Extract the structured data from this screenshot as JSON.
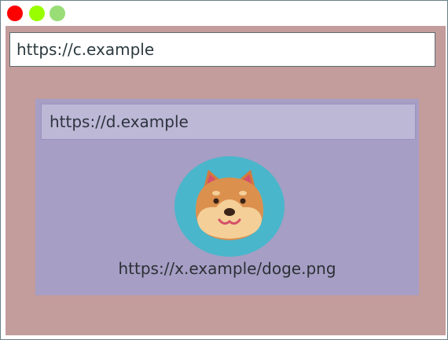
{
  "window": {
    "traffic_lights": [
      {
        "name": "close",
        "color": "#ff0000"
      },
      {
        "name": "minimize",
        "color": "#99ff00"
      },
      {
        "name": "maximize",
        "color": "#99dd77"
      }
    ]
  },
  "outer_frame": {
    "url": "https://c.example",
    "background": "#c39c9c"
  },
  "inner_frame": {
    "url": "https://d.example",
    "background": "#a69ec4",
    "url_bar_background": "#bdb8d6",
    "image": {
      "icon": "shiba-dog-face-icon",
      "src_text": "https://x.example/doge.png"
    }
  }
}
